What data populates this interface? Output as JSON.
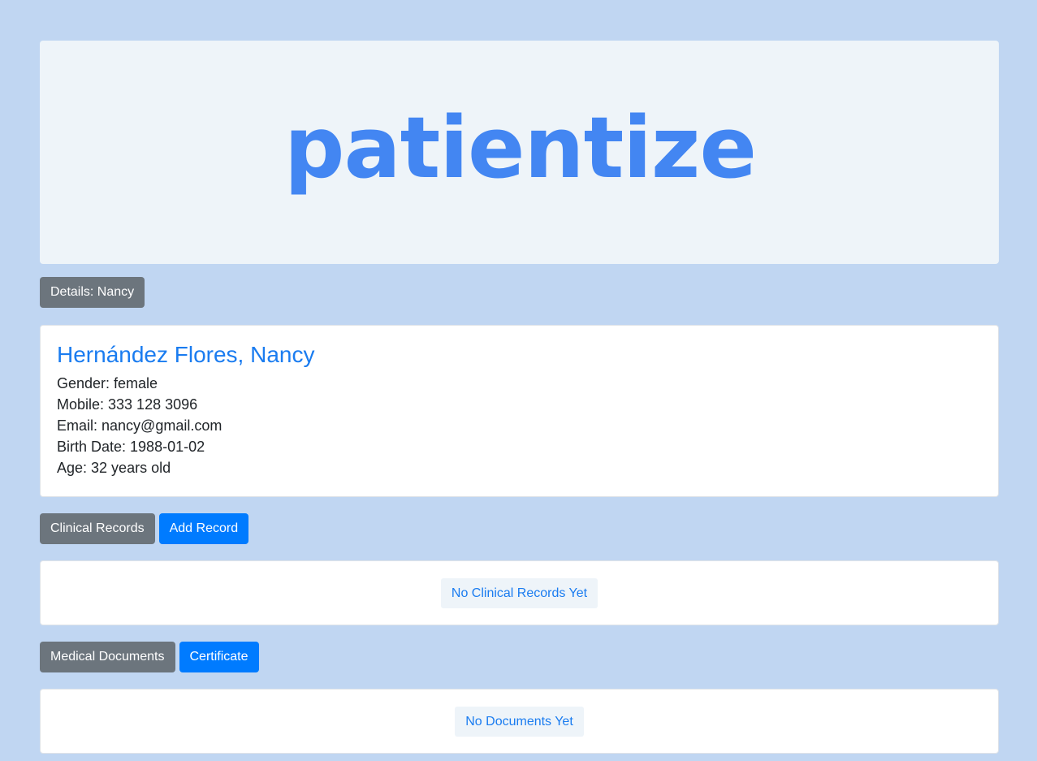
{
  "brand": {
    "logo_text": "patientize"
  },
  "details_button": {
    "label": "Details: Nancy"
  },
  "patient": {
    "name": "Hernández Flores, Nancy",
    "gender": "Gender: female",
    "mobile": "Mobile: 333 128 3096",
    "email": "Email: nancy@gmail.com",
    "birth_date": "Birth Date: 1988-01-02",
    "age": "Age: 32 years old"
  },
  "clinical_records": {
    "section_label": "Clinical Records",
    "add_label": "Add Record",
    "empty_text": "No Clinical Records Yet"
  },
  "medical_documents": {
    "section_label": "Medical Documents",
    "certificate_label": "Certificate",
    "empty_text": "No Documents Yet"
  },
  "colors": {
    "background": "#c0d6f2",
    "brand": "#4386f2",
    "primary": "#007bff",
    "secondary": "#6c757d"
  }
}
